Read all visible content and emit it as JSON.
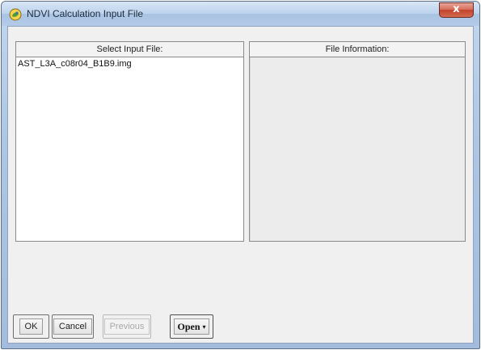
{
  "window": {
    "title": "NDVI Calculation Input File",
    "close_glyph": "x"
  },
  "input_pane": {
    "header": "Select Input File:",
    "files": [
      "AST_L3A_c08r04_B1B9.img"
    ]
  },
  "info_pane": {
    "header": "File Information:"
  },
  "buttons": {
    "ok": "OK",
    "cancel": "Cancel",
    "previous": "Previous",
    "open": "Open",
    "open_caret": "▾"
  }
}
